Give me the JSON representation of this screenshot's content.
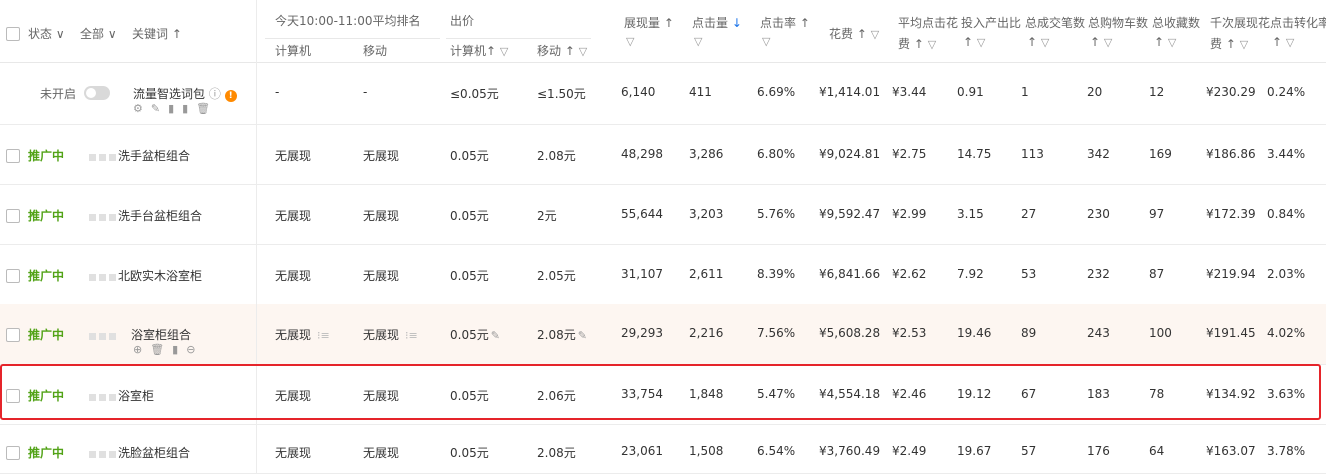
{
  "header": {
    "status": "状态",
    "all": "全部",
    "keyword": "关键词",
    "rank_title": "今天10:00-11:00平均排名",
    "computer": "计算机",
    "mobile": "移动",
    "bid_title": "出价",
    "bid_computer": "计算机",
    "bid_mobile": "移动",
    "impressions": "展现量",
    "clicks": "点击量",
    "ctr": "点击率",
    "spend": "花费",
    "avg_cpc_1": "平均点击花",
    "avg_cpc_2": "费",
    "roi_1": "投入产出比",
    "orders": "总成交笔数",
    "carts": "总购物车数",
    "favs": "总收藏数",
    "cpm_1": "千次展现花",
    "cpm_2": "费",
    "cvr": "点击转化率"
  },
  "rows": [
    {
      "status": "未开启",
      "keyword": "流量智选词包",
      "rank_pc": "-",
      "rank_mobile": "-",
      "bid_pc": "≤0.05元",
      "bid_mobile": "≤1.50元",
      "impressions": "6,140",
      "clicks": "411",
      "ctr": "6.69%",
      "spend": "¥1,414.01",
      "avg_cpc": "¥3.44",
      "roi": "0.91",
      "orders": "1",
      "carts": "20",
      "favs": "12",
      "cpm": "¥230.29",
      "cvr": "0.24%"
    },
    {
      "status": "推广中",
      "keyword": "洗手盆柜组合",
      "rank_pc": "无展现",
      "rank_mobile": "无展现",
      "bid_pc": "0.05元",
      "bid_mobile": "2.08元",
      "impressions": "48,298",
      "clicks": "3,286",
      "ctr": "6.80%",
      "spend": "¥9,024.81",
      "avg_cpc": "¥2.75",
      "roi": "14.75",
      "orders": "113",
      "carts": "342",
      "favs": "169",
      "cpm": "¥186.86",
      "cvr": "3.44%"
    },
    {
      "status": "推广中",
      "keyword": "洗手台盆柜组合",
      "rank_pc": "无展现",
      "rank_mobile": "无展现",
      "bid_pc": "0.05元",
      "bid_mobile": "2元",
      "impressions": "55,644",
      "clicks": "3,203",
      "ctr": "5.76%",
      "spend": "¥9,592.47",
      "avg_cpc": "¥2.99",
      "roi": "3.15",
      "orders": "27",
      "carts": "230",
      "favs": "97",
      "cpm": "¥172.39",
      "cvr": "0.84%"
    },
    {
      "status": "推广中",
      "keyword": "北欧实木浴室柜",
      "rank_pc": "无展现",
      "rank_mobile": "无展现",
      "bid_pc": "0.05元",
      "bid_mobile": "2.05元",
      "impressions": "31,107",
      "clicks": "2,611",
      "ctr": "8.39%",
      "spend": "¥6,841.66",
      "avg_cpc": "¥2.62",
      "roi": "7.92",
      "orders": "53",
      "carts": "232",
      "favs": "87",
      "cpm": "¥219.94",
      "cvr": "2.03%"
    },
    {
      "status": "推广中",
      "keyword": "浴室柜组合",
      "rank_pc": "无展现",
      "rank_mobile": "无展现",
      "bid_pc": "0.05元",
      "bid_mobile": "2.08元",
      "impressions": "29,293",
      "clicks": "2,216",
      "ctr": "7.56%",
      "spend": "¥5,608.28",
      "avg_cpc": "¥2.53",
      "roi": "19.46",
      "orders": "89",
      "carts": "243",
      "favs": "100",
      "cpm": "¥191.45",
      "cvr": "4.02%"
    },
    {
      "status": "推广中",
      "keyword": "浴室柜",
      "rank_pc": "无展现",
      "rank_mobile": "无展现",
      "bid_pc": "0.05元",
      "bid_mobile": "2.06元",
      "impressions": "33,754",
      "clicks": "1,848",
      "ctr": "5.47%",
      "spend": "¥4,554.18",
      "avg_cpc": "¥2.46",
      "roi": "19.12",
      "orders": "67",
      "carts": "183",
      "favs": "78",
      "cpm": "¥134.92",
      "cvr": "3.63%"
    },
    {
      "status": "推广中",
      "keyword": "洗脸盆柜组合",
      "rank_pc": "无展现",
      "rank_mobile": "无展现",
      "bid_pc": "0.05元",
      "bid_mobile": "2.08元",
      "impressions": "23,061",
      "clicks": "1,508",
      "ctr": "6.54%",
      "spend": "¥3,760.49",
      "avg_cpc": "¥2.49",
      "roi": "19.67",
      "orders": "57",
      "carts": "176",
      "favs": "64",
      "cpm": "¥163.07",
      "cvr": "3.78%"
    }
  ],
  "colors": {
    "active_status": "#52a317",
    "highlight_border": "#e5242a",
    "row_highlight": "#fdf6f1",
    "sort_active": "#1a73e8"
  }
}
